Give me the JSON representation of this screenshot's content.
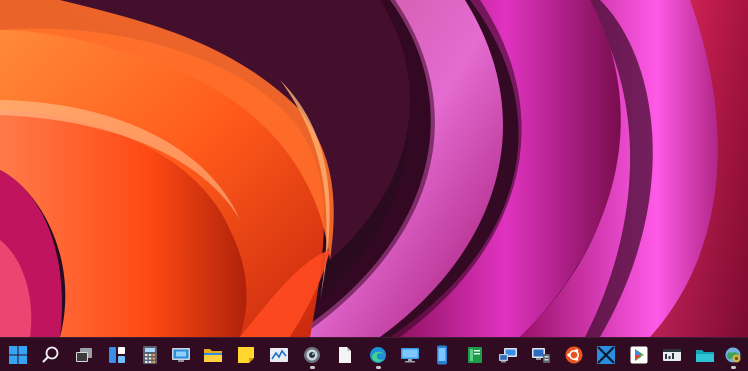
{
  "desktop": {
    "wallpaper": "abstract-curves-wallpaper"
  },
  "taskbar": {
    "items": [
      {
        "name": "start-button",
        "icon": "windows-logo-icon",
        "running": false
      },
      {
        "name": "search-button",
        "icon": "search-icon",
        "running": false
      },
      {
        "name": "task-view-button",
        "icon": "task-view-icon",
        "running": false
      },
      {
        "name": "widgets-button",
        "icon": "widgets-icon",
        "running": false
      },
      {
        "name": "calculator-button",
        "icon": "calculator-icon",
        "running": false
      },
      {
        "name": "remote-desktop-button",
        "icon": "remote-desktop-icon",
        "running": false
      },
      {
        "name": "file-explorer-button",
        "icon": "folder-icon",
        "running": false
      },
      {
        "name": "sticky-notes-button",
        "icon": "sticky-note-icon",
        "running": false
      },
      {
        "name": "performance-monitor-button",
        "icon": "chart-monitor-icon",
        "running": false
      },
      {
        "name": "camera-button",
        "icon": "camera-lens-icon",
        "running": true
      },
      {
        "name": "notepad-button",
        "icon": "document-icon",
        "running": false
      },
      {
        "name": "edge-button",
        "icon": "edge-browser-icon",
        "running": true
      },
      {
        "name": "display-button",
        "icon": "monitor-icon",
        "running": false
      },
      {
        "name": "phone-link-button",
        "icon": "phone-icon",
        "running": false
      },
      {
        "name": "spreadsheet-button",
        "icon": "green-book-icon",
        "running": false
      },
      {
        "name": "network-button",
        "icon": "network-computer-icon",
        "running": false
      },
      {
        "name": "device-manager-button",
        "icon": "device-manager-icon",
        "running": false
      },
      {
        "name": "ubuntu-button",
        "icon": "ubuntu-icon",
        "running": false
      },
      {
        "name": "snipping-button",
        "icon": "snip-cross-icon",
        "running": false
      },
      {
        "name": "play-store-button",
        "icon": "play-store-icon",
        "running": false
      },
      {
        "name": "task-manager-button",
        "icon": "task-manager-icon",
        "running": false
      },
      {
        "name": "folder-button",
        "icon": "teal-folder-icon",
        "running": false
      },
      {
        "name": "settings-globe-button",
        "icon": "globe-gear-icon",
        "running": true
      }
    ]
  },
  "colors": {
    "wallpaper_orange": "#ff5a1a",
    "wallpaper_magenta": "#d81a9e",
    "wallpaper_pink": "#f06ae0",
    "wallpaper_shadow": "#2a0a1e",
    "taskbar": "#360c24"
  }
}
